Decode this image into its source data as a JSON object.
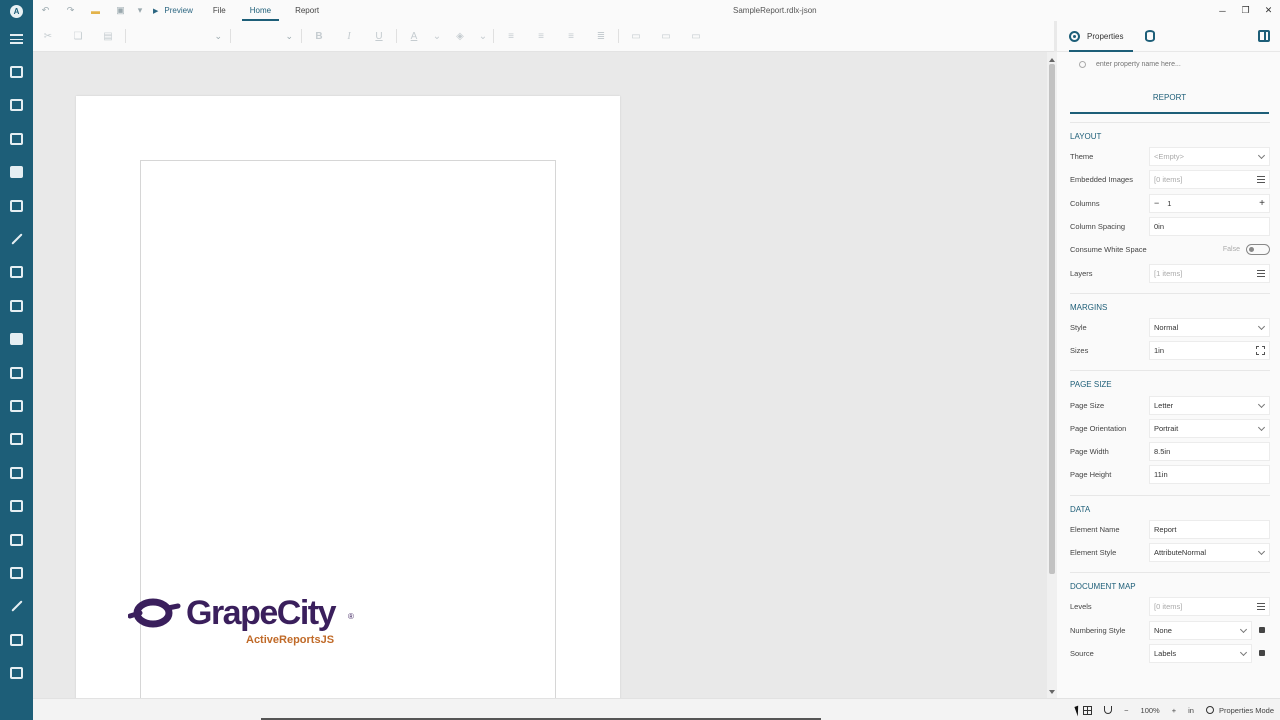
{
  "app": {
    "logo_letter": "A"
  },
  "topbar": {
    "preview_label": "Preview",
    "menus": [
      "File",
      "Home",
      "Report"
    ],
    "active_menu": "Home",
    "document_title": "SampleReport.rdlx-json"
  },
  "canvas": {
    "brand_name": "GrapeCity",
    "brand_registered": "®",
    "brand_product": "ActiveReportsJS"
  },
  "panel": {
    "tab_properties": "Properties",
    "search_placeholder": "enter property name here...",
    "object_title": "REPORT",
    "layout": {
      "title": "LAYOUT",
      "theme_label": "Theme",
      "theme_value": "<Empty>",
      "embedded_images_label": "Embedded Images",
      "embedded_images_value": "[0 items]",
      "columns_label": "Columns",
      "columns_value": "1",
      "column_spacing_label": "Column Spacing",
      "column_spacing_value": "0in",
      "consume_ws_label": "Consume White Space",
      "consume_ws_value": "False",
      "layers_label": "Layers",
      "layers_value": "[1 items]"
    },
    "margins": {
      "title": "MARGINS",
      "style_label": "Style",
      "style_value": "Normal",
      "sizes_label": "Sizes",
      "sizes_value": "1in"
    },
    "page_size": {
      "title": "PAGE SIZE",
      "page_size_label": "Page Size",
      "page_size_value": "Letter",
      "orientation_label": "Page Orientation",
      "orientation_value": "Portrait",
      "width_label": "Page Width",
      "width_value": "8.5in",
      "height_label": "Page Height",
      "height_value": "11in"
    },
    "data": {
      "title": "DATA",
      "element_name_label": "Element Name",
      "element_name_value": "Report",
      "element_style_label": "Element Style",
      "element_style_value": "AttributeNormal"
    },
    "document_map": {
      "title": "DOCUMENT MAP",
      "levels_label": "Levels",
      "levels_value": "[0 items]",
      "numbering_label": "Numbering Style",
      "numbering_value": "None",
      "source_label": "Source",
      "source_value": "Labels"
    }
  },
  "statusbar": {
    "zoom": "100%",
    "units": "in",
    "mode": "Properties Mode"
  },
  "colors": {
    "sidebar": "#1d5e78",
    "accent": "#1d5e78",
    "brand_purple": "#3a1f5c",
    "brand_orange": "#c06a28"
  }
}
